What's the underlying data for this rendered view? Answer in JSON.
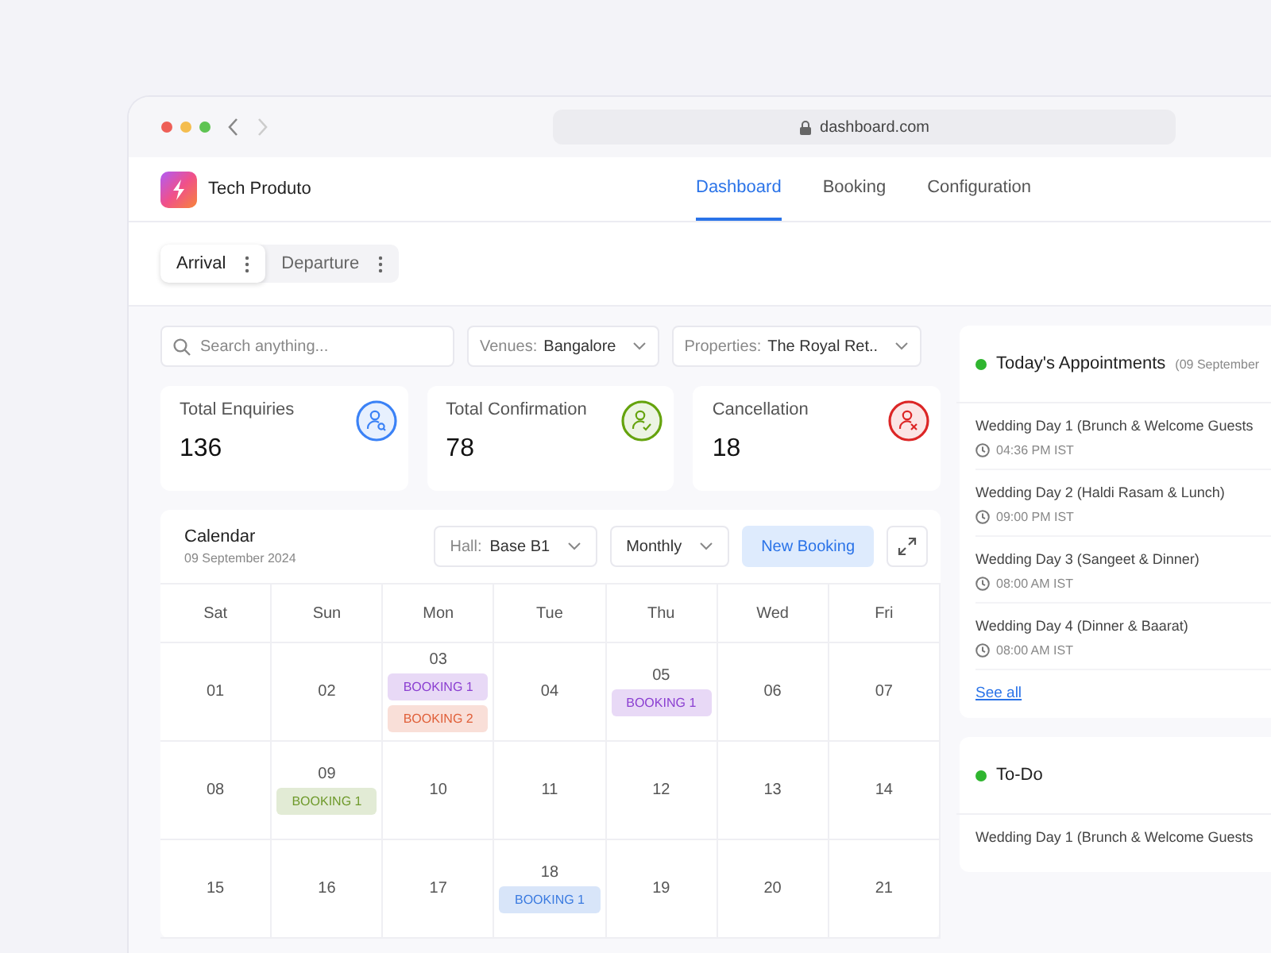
{
  "browser": {
    "url": "dashboard.com"
  },
  "app": {
    "brand": "Tech Produto",
    "nav": [
      {
        "label": "Dashboard",
        "selected": true
      },
      {
        "label": "Booking",
        "selected": false
      },
      {
        "label": "Configuration",
        "selected": false
      }
    ],
    "view_tabs": [
      {
        "label": "Arrival",
        "selected": true
      },
      {
        "label": "Departure",
        "selected": false
      }
    ]
  },
  "filters": {
    "search": {
      "placeholder": "Search anything..."
    },
    "venue": {
      "label": "Venues:",
      "value": "Bangalore"
    },
    "property": {
      "label": "Properties:",
      "value": "The Royal Ret.."
    }
  },
  "stats": [
    {
      "kind": "enquiry",
      "label": "Total Enquiries",
      "value": "136",
      "color": "#3b82f6"
    },
    {
      "kind": "confirm",
      "label": "Total Confirmation",
      "value": "78",
      "color": "#65a30d"
    },
    {
      "kind": "cancel",
      "label": "Cancellation",
      "value": "18",
      "color": "#dc2626"
    }
  ],
  "calendar": {
    "title": "Calendar",
    "date": "09 September 2024",
    "hall": {
      "label": "Hall:",
      "value": "Base B1"
    },
    "period": "Monthly",
    "new_booking": "New Booking",
    "weekdays": [
      "Sat",
      "Sun",
      "Mon",
      "Tue",
      "Thu",
      "Wed",
      "Fri"
    ],
    "weeks": [
      [
        {
          "day": "01"
        },
        {
          "day": "02"
        },
        {
          "day": "03",
          "bookings": [
            {
              "label": "BOOKING 1",
              "color": "#8b3fd1"
            },
            {
              "label": "BOOKING 2",
              "color": "#e0603a"
            }
          ]
        },
        {
          "day": "04"
        },
        {
          "day": "05",
          "bookings": [
            {
              "label": "BOOKING 1",
              "color": "#8b3fd1"
            }
          ]
        },
        {
          "day": "06"
        },
        {
          "day": "07"
        }
      ],
      [
        {
          "day": "08"
        },
        {
          "day": "09",
          "bookings": [
            {
              "label": "BOOKING 1",
              "color": "#6f9a2c"
            }
          ]
        },
        {
          "day": "10"
        },
        {
          "day": "11"
        },
        {
          "day": "12"
        },
        {
          "day": "13"
        },
        {
          "day": "14"
        }
      ],
      [
        {
          "day": "15"
        },
        {
          "day": "16"
        },
        {
          "day": "17"
        },
        {
          "day": "18",
          "bookings": [
            {
              "label": "BOOKING 1",
              "color": "#3b7be0"
            }
          ]
        },
        {
          "day": "19"
        },
        {
          "day": "20"
        },
        {
          "day": "21"
        }
      ]
    ]
  },
  "appointments": {
    "title": "Today's Appointments",
    "date": "(09 September",
    "color": "#2fb52f",
    "items": [
      {
        "title": "Wedding Day 1 (Brunch & Welcome Guests",
        "time": "04:36 PM IST"
      },
      {
        "title": "Wedding Day 2 (Haldi Rasam & Lunch)",
        "time": "09:00 PM IST"
      },
      {
        "title": "Wedding Day 3 (Sangeet & Dinner)",
        "time": "08:00 AM IST"
      },
      {
        "title": "Wedding Day 4 (Dinner & Baarat)",
        "time": "08:00 AM IST"
      }
    ],
    "see_all": "See all"
  },
  "todo": {
    "title": "To-Do",
    "color": "#2fb52f",
    "items": [
      {
        "title": "Wedding Day 1 (Brunch & Welcome Guests"
      }
    ]
  }
}
